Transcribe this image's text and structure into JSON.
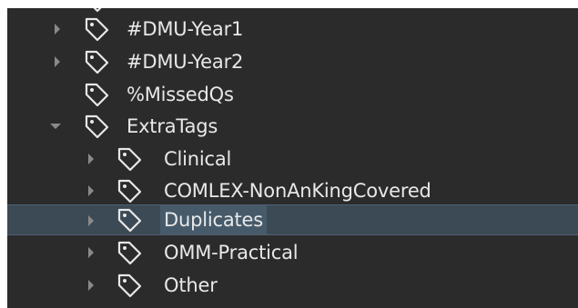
{
  "tree": {
    "items": [
      {
        "label": "#DMU-Year1",
        "expand": "collapsed"
      },
      {
        "label": "#DMU-Year2",
        "expand": "collapsed"
      },
      {
        "label": "%MissedQs",
        "expand": "none"
      },
      {
        "label": "ExtraTags",
        "expand": "expanded"
      },
      {
        "label": "Clinical",
        "expand": "collapsed"
      },
      {
        "label": "COMLEX-NonAnKingCovered",
        "expand": "collapsed"
      },
      {
        "label": "Duplicates",
        "expand": "collapsed",
        "selected": true
      },
      {
        "label": "OMM-Practical",
        "expand": "collapsed"
      },
      {
        "label": "Other",
        "expand": "collapsed"
      }
    ]
  },
  "colors": {
    "background": "#2b2b2b",
    "text": "#e8e8e8",
    "selected_row": "#3c4a55",
    "selected_label": "#465a6a",
    "icon_stroke": "#e8e8e8",
    "arrow": "#8a8a8a"
  },
  "icons": {
    "tag": "tag-icon",
    "collapsed": "chevron-right-icon",
    "expanded": "chevron-down-icon"
  }
}
